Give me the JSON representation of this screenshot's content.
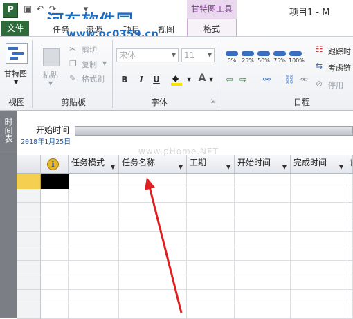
{
  "titlebar": {
    "app_icon": "P",
    "qat_icons": [
      "save-icon",
      "undo-icon",
      "redo-icon",
      "customize-icon"
    ],
    "watermark_title": "河东软件园",
    "watermark_url": "www.pc0359.cn",
    "context_group": "甘特图工具",
    "window_title": "项目1 - M"
  },
  "tabs": {
    "file": "文件",
    "task": "任务",
    "resource": "资源",
    "project": "项目",
    "view": "视图",
    "format": "格式"
  },
  "ribbon": {
    "view_group": {
      "label": "视图",
      "button": "甘特图"
    },
    "clipboard_group": {
      "label": "剪贴板",
      "paste": "粘贴",
      "cut": "剪切",
      "copy": "复制",
      "format_painter": "格式刷"
    },
    "font_group": {
      "label": "字体",
      "font_name": "宋体",
      "font_size": "11",
      "bold": "B",
      "italic": "I",
      "underline": "U",
      "font_color": "A"
    },
    "schedule_group": {
      "label": "日程",
      "progress_labels": [
        "0%",
        "25%",
        "50%",
        "75%",
        "100%"
      ],
      "follow": "跟踪时",
      "respect_links": "考虑链",
      "inactivate": "停用"
    }
  },
  "timeline": {
    "side_label": "时间表",
    "start_label": "开始时间",
    "start_date": "2018年1月25日"
  },
  "sheet": {
    "columns": [
      "任务模式",
      "任务名称",
      "工期",
      "开始时间",
      "完成时间",
      "前"
    ],
    "info_icon": "i"
  },
  "watermark_mid": "www.pHome.NET",
  "colors": {
    "file_tab": "#2f6b3a",
    "context_tab": "#ead8ef",
    "selected_row": "#f5cf4f",
    "arrow": "#e02020",
    "progress_bar": "#3a6fbf"
  }
}
